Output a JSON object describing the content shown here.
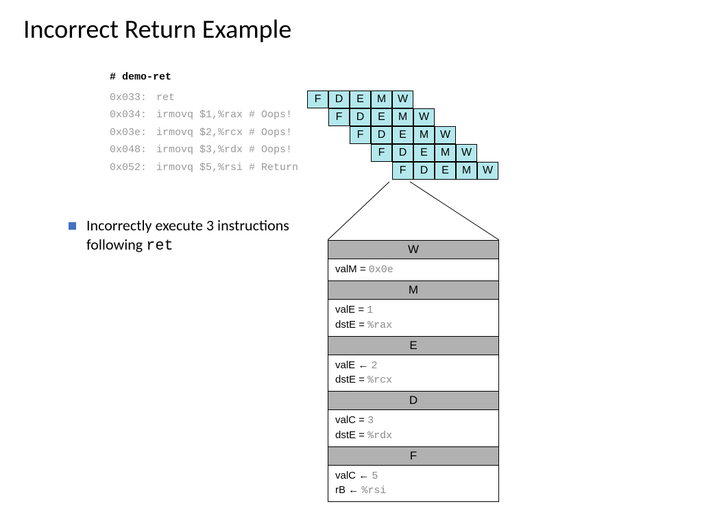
{
  "title": "Incorrect Return Example",
  "code_header": "# demo-ret",
  "instructions": [
    {
      "addr": "0x033:",
      "text": "ret"
    },
    {
      "addr": "0x034:",
      "text": "irmovq $1,%rax # Oops!"
    },
    {
      "addr": "0x03e:",
      "text": "irmovq $2,%rcx # Oops!"
    },
    {
      "addr": "0x048:",
      "text": "irmovq $3,%rdx # Oops!"
    },
    {
      "addr": "0x052:",
      "text": "irmovq $5,%rsi # Return"
    }
  ],
  "stages": [
    "F",
    "D",
    "E",
    "M",
    "W"
  ],
  "bullet_text_a": "Incorrectly execute 3 instructions following ",
  "bullet_text_b": "ret",
  "stack": [
    {
      "hdr": "W",
      "lines": [
        {
          "l": "valM = ",
          "m": "0x0e"
        }
      ]
    },
    {
      "hdr": "M",
      "lines": [
        {
          "l": "valE = ",
          "m": "1"
        },
        {
          "l": "dstE = ",
          "m": "%rax"
        }
      ]
    },
    {
      "hdr": "E",
      "lines": [
        {
          "l": "valE ← ",
          "m": "2"
        },
        {
          "l": "dstE = ",
          "m": "%rcx"
        }
      ]
    },
    {
      "hdr": "D",
      "lines": [
        {
          "l": "valC = ",
          "m": "3"
        },
        {
          "l": "dstE = ",
          "m": "%rdx"
        }
      ]
    },
    {
      "hdr": "F",
      "lines": [
        {
          "l": "valC ← ",
          "m": "5"
        },
        {
          "l": "rB ← ",
          "m": "%rsi"
        }
      ]
    }
  ]
}
